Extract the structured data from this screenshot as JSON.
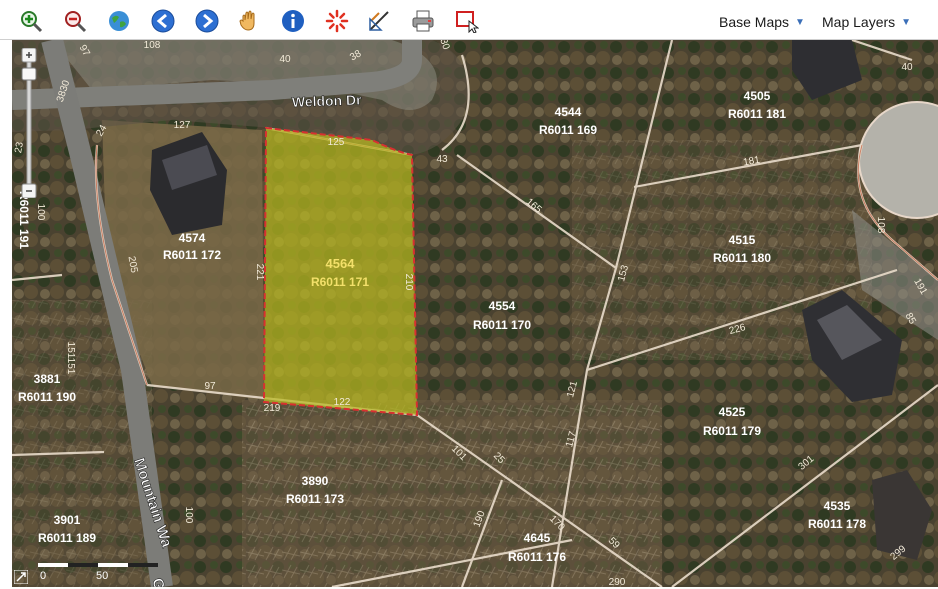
{
  "toolbar": {
    "tools": [
      {
        "name": "zoom-in-icon"
      },
      {
        "name": "zoom-out-icon"
      },
      {
        "name": "globe-icon"
      },
      {
        "name": "back-arrow-icon"
      },
      {
        "name": "forward-arrow-icon"
      },
      {
        "name": "pan-hand-icon"
      },
      {
        "name": "info-icon"
      },
      {
        "name": "identify-burst-icon"
      },
      {
        "name": "measure-icon"
      },
      {
        "name": "print-icon"
      },
      {
        "name": "select-box-icon"
      }
    ],
    "base_maps_label": "Base Maps",
    "map_layers_label": "Map Layers"
  },
  "map": {
    "streets": {
      "weldon": "Weldon Dr",
      "mountain": "Mountain Wa",
      "mountain_end": "G"
    },
    "highlight": {
      "number": "4564",
      "id": "R6011 171",
      "color": "#b8b820"
    },
    "parcels": [
      {
        "number": "4574",
        "id": "R6011 172"
      },
      {
        "number": "4544",
        "id": "R6011 169"
      },
      {
        "number": "4505",
        "id": "R6011 181"
      },
      {
        "number": "4515",
        "id": "R6011 180"
      },
      {
        "number": "4554",
        "id": "R6011 170"
      },
      {
        "number": "3881",
        "id": "R6011 190"
      },
      {
        "number": "4525",
        "id": "R6011 179"
      },
      {
        "number": "3890",
        "id": "R6011 173"
      },
      {
        "number": "3901",
        "id": "R6011 189"
      },
      {
        "number": "4645",
        "id": "R6011 176"
      },
      {
        "number": "4535",
        "id": "R6011 178"
      }
    ],
    "dims": [
      "108",
      "97",
      "40",
      "127",
      "125",
      "43",
      "24",
      "122",
      "219",
      "97",
      "221",
      "210",
      "165",
      "153",
      "181",
      "40",
      "108",
      "205",
      "100",
      "100",
      "151",
      "191",
      "121",
      "85",
      "226",
      "301",
      "117",
      "101",
      "299",
      "170",
      "30",
      "59",
      "190",
      "25",
      "290",
      "151",
      "23",
      "3830",
      "38"
    ],
    "left_edge_id": "R6011 191",
    "scale": {
      "zero": "0",
      "fifty": "50"
    }
  }
}
